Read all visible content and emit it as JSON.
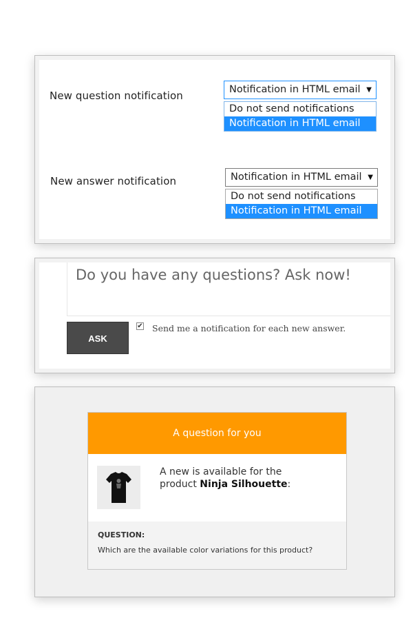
{
  "notification_settings": {
    "question": {
      "label": "New question notification",
      "selected": "Notification in HTML email",
      "options": [
        "Do not send notifications",
        "Notification in HTML email"
      ]
    },
    "answer": {
      "label": "New answer notification",
      "selected": "Notification in HTML email",
      "options": [
        "Do not send notifications",
        "Notification in HTML email"
      ]
    }
  },
  "ask_form": {
    "placeholder": "Do you have any questions? Ask now!",
    "button_label": "ASK",
    "notify_checked": true,
    "notify_label": "Send me a notification for each new answer."
  },
  "email_preview": {
    "header": "A question for you",
    "intro_prefix": "A new is available for the product ",
    "product_name": "Ninja Silhouette",
    "intro_suffix": ":",
    "question_label": "QUESTION:",
    "question_text": "Which are the available color variations for this product?",
    "accent_color": "#ff9900"
  },
  "icons": {
    "select_arrow": "dropdown-arrow-icon",
    "checkbox": "checkmark-icon",
    "product": "tshirt-image"
  }
}
